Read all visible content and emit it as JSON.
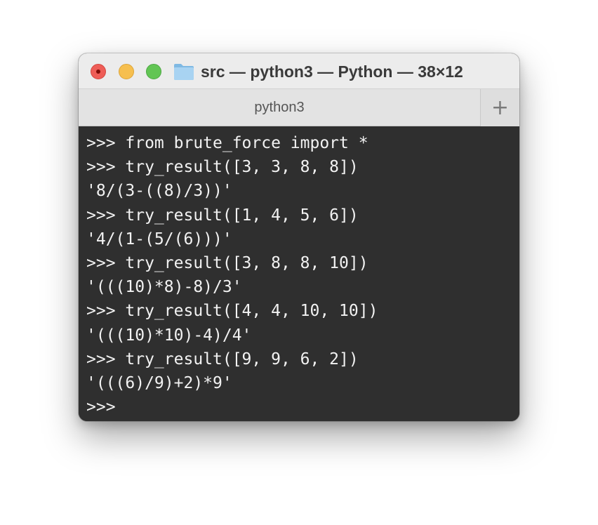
{
  "window": {
    "title": "src — python3 — Python — 38×12",
    "folder_icon": "folder-icon"
  },
  "traffic_lights": {
    "close_color": "#ee5d57",
    "minimize_color": "#f6bf4f",
    "zoom_color": "#62c554"
  },
  "tabs": [
    {
      "label": "python3"
    }
  ],
  "new_tab_label": "+",
  "terminal": {
    "background": "#2f2f2f",
    "foreground": "#f2f2f2",
    "lines": [
      ">>> from brute_force import *",
      ">>> try_result([3, 3, 8, 8])",
      "'8/(3-((8)/3))'",
      ">>> try_result([1, 4, 5, 6])",
      "'4/(1-(5/(6)))'",
      ">>> try_result([3, 8, 8, 10])",
      "'(((10)*8)-8)/3'",
      ">>> try_result([4, 4, 10, 10])",
      "'(((10)*10)-4)/4'",
      ">>> try_result([9, 9, 6, 2])",
      "'(((6)/9)+2)*9'",
      ">>> "
    ]
  }
}
